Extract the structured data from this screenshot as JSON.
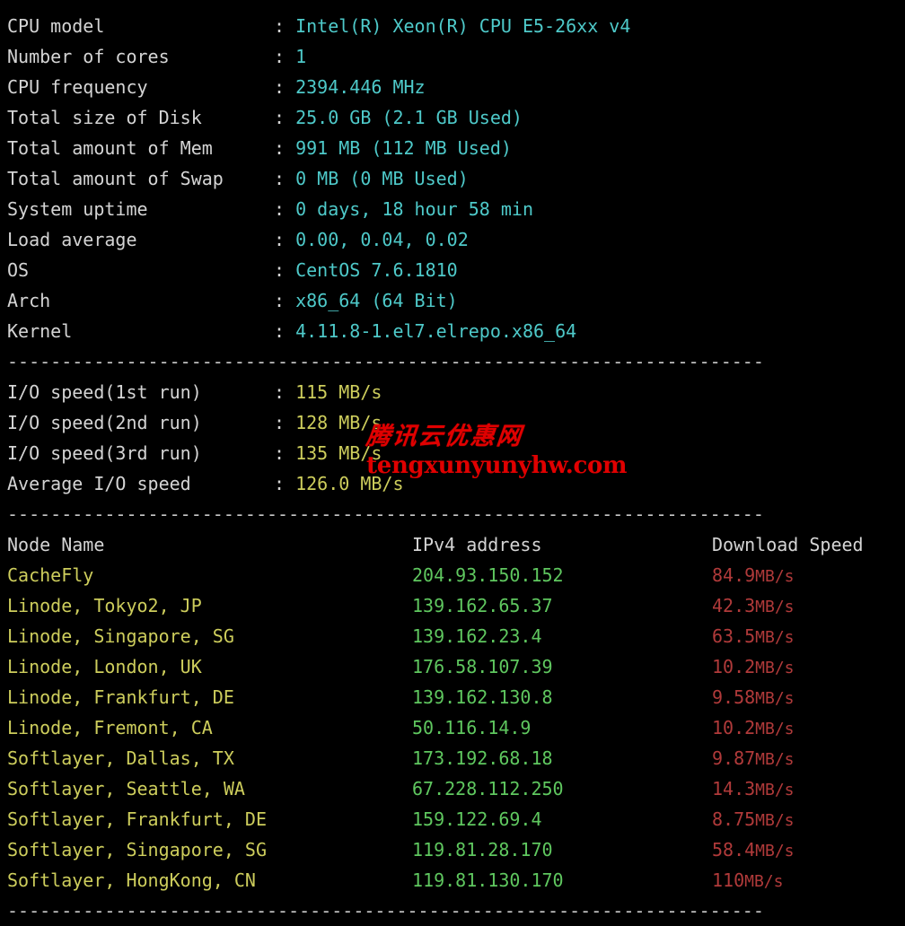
{
  "terminal": {
    "background_color": "#000000",
    "default_text_color": "#d4d4d4",
    "palette": {
      "cyan": "#4ec9c9",
      "yellow": "#cdcd5c",
      "green": "#5fc75f",
      "red": "#b03a3a",
      "white": "#d4d4d4"
    },
    "separator": "----------------------------------------------------------------------",
    "colon": ":"
  },
  "system_info": [
    {
      "label": "CPU model",
      "value": "Intel(R) Xeon(R) CPU E5-26xx v4"
    },
    {
      "label": "Number of cores",
      "value": "1"
    },
    {
      "label": "CPU frequency",
      "value": "2394.446 MHz"
    },
    {
      "label": "Total size of Disk",
      "value": "25.0 GB (2.1 GB Used)"
    },
    {
      "label": "Total amount of Mem",
      "value": "991 MB (112 MB Used)"
    },
    {
      "label": "Total amount of Swap",
      "value": "0 MB (0 MB Used)"
    },
    {
      "label": "System uptime",
      "value": "0 days, 18 hour 58 min"
    },
    {
      "label": "Load average",
      "value": "0.00, 0.04, 0.02"
    },
    {
      "label": "OS",
      "value": "CentOS 7.6.1810"
    },
    {
      "label": "Arch",
      "value": "x86_64 (64 Bit)"
    },
    {
      "label": "Kernel",
      "value": "4.11.8-1.el7.elrepo.x86_64"
    }
  ],
  "io_tests": [
    {
      "label": "I/O speed(1st run)",
      "value": "115 MB/s"
    },
    {
      "label": "I/O speed(2nd run)",
      "value": "128 MB/s"
    },
    {
      "label": "I/O speed(3rd run)",
      "value": "135 MB/s"
    },
    {
      "label": "Average I/O speed",
      "value": "126.0 MB/s"
    }
  ],
  "node_table": {
    "headers": {
      "node_name": "Node Name",
      "ipv4": "IPv4 address",
      "download_speed": "Download Speed"
    },
    "rows": [
      {
        "node_name": "CacheFly",
        "ipv4": "204.93.150.152",
        "speed_number": "84.9",
        "speed_unit": "MB/s"
      },
      {
        "node_name": "Linode, Tokyo2, JP",
        "ipv4": "139.162.65.37",
        "speed_number": "42.3",
        "speed_unit": "MB/s"
      },
      {
        "node_name": "Linode, Singapore, SG",
        "ipv4": "139.162.23.4",
        "speed_number": "63.5",
        "speed_unit": "MB/s"
      },
      {
        "node_name": "Linode, London, UK",
        "ipv4": "176.58.107.39",
        "speed_number": "10.2",
        "speed_unit": "MB/s"
      },
      {
        "node_name": "Linode, Frankfurt, DE",
        "ipv4": "139.162.130.8",
        "speed_number": "9.58",
        "speed_unit": "MB/s"
      },
      {
        "node_name": "Linode, Fremont, CA",
        "ipv4": "50.116.14.9",
        "speed_number": "10.2",
        "speed_unit": "MB/s"
      },
      {
        "node_name": "Softlayer, Dallas, TX",
        "ipv4": "173.192.68.18",
        "speed_number": "9.87",
        "speed_unit": "MB/s"
      },
      {
        "node_name": "Softlayer, Seattle, WA",
        "ipv4": "67.228.112.250",
        "speed_number": "14.3",
        "speed_unit": "MB/s"
      },
      {
        "node_name": "Softlayer, Frankfurt, DE",
        "ipv4": "159.122.69.4",
        "speed_number": "8.75",
        "speed_unit": "MB/s"
      },
      {
        "node_name": "Softlayer, Singapore, SG",
        "ipv4": "119.81.28.170",
        "speed_number": "58.4",
        "speed_unit": "MB/s"
      },
      {
        "node_name": "Softlayer, HongKong, CN",
        "ipv4": "119.81.130.170",
        "speed_number": "110",
        "speed_unit": "MB/s"
      }
    ]
  },
  "watermark": {
    "chinese_text": "腾讯云优惠网",
    "url_text": "tengxunyunyhw.com",
    "color": "#e00000"
  }
}
